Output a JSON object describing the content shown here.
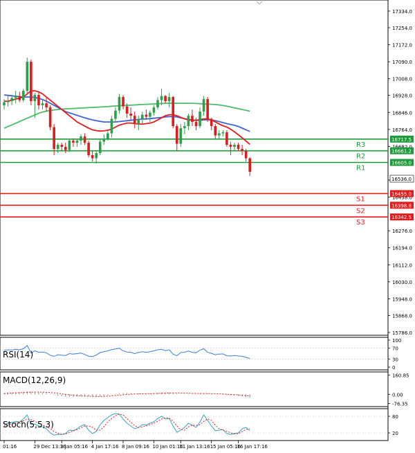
{
  "colors": {
    "up": "#2e9e4a",
    "down": "#d91e1e",
    "ma_fast": "#e81c1c",
    "ma_mid": "#3f63d6",
    "ma_slow": "#4cbc6a",
    "resistance": "#1f9a3a",
    "support": "#e01d1d",
    "rsi": "#3a7fd5",
    "macd": "#8a8a8a",
    "signal": "#e81c1c",
    "stoch_k": "#35a4c7",
    "stoch_d": "#e81c1c"
  },
  "chart_data": {
    "type": "candlestick",
    "main": {
      "y_ticks": [
        "17334.0",
        "17254.0",
        "17172.0",
        "17090.0",
        "17008.0",
        "16928.0",
        "16846.0",
        "16764.0",
        "16682.0",
        "16520.0",
        "16438.0",
        "16276.0",
        "16194.0",
        "16112.0",
        "16030.0",
        "15948.0",
        "15868.0",
        "15786.0"
      ],
      "ylim": [
        15786,
        17374
      ],
      "current_price": "16536.0",
      "candles": [
        {
          "o": 16880,
          "h": 16910,
          "l": 16860,
          "c": 16895
        },
        {
          "o": 16895,
          "h": 16925,
          "l": 16875,
          "c": 16900
        },
        {
          "o": 16900,
          "h": 16930,
          "l": 16880,
          "c": 16915
        },
        {
          "o": 16915,
          "h": 16950,
          "l": 16890,
          "c": 16925
        },
        {
          "o": 16925,
          "h": 16945,
          "l": 16895,
          "c": 16905
        },
        {
          "o": 16905,
          "h": 16960,
          "l": 16895,
          "c": 16950
        },
        {
          "o": 16950,
          "h": 17110,
          "l": 16930,
          "c": 17090
        },
        {
          "o": 17090,
          "h": 17100,
          "l": 16880,
          "c": 16900
        },
        {
          "o": 16900,
          "h": 16940,
          "l": 16820,
          "c": 16930
        },
        {
          "o": 16930,
          "h": 16945,
          "l": 16860,
          "c": 16880
        },
        {
          "o": 16880,
          "h": 16905,
          "l": 16860,
          "c": 16890
        },
        {
          "o": 16890,
          "h": 16915,
          "l": 16850,
          "c": 16870
        },
        {
          "o": 16870,
          "h": 16880,
          "l": 16760,
          "c": 16775
        },
        {
          "o": 16775,
          "h": 16790,
          "l": 16640,
          "c": 16670
        },
        {
          "o": 16670,
          "h": 16700,
          "l": 16650,
          "c": 16690
        },
        {
          "o": 16690,
          "h": 16700,
          "l": 16660,
          "c": 16680
        },
        {
          "o": 16680,
          "h": 16700,
          "l": 16650,
          "c": 16665
        },
        {
          "o": 16665,
          "h": 16720,
          "l": 16655,
          "c": 16710
        },
        {
          "o": 16710,
          "h": 16720,
          "l": 16680,
          "c": 16700
        },
        {
          "o": 16700,
          "h": 16720,
          "l": 16680,
          "c": 16710
        },
        {
          "o": 16710,
          "h": 16740,
          "l": 16690,
          "c": 16730
        },
        {
          "o": 16730,
          "h": 16745,
          "l": 16690,
          "c": 16700
        },
        {
          "o": 16700,
          "h": 16710,
          "l": 16630,
          "c": 16640
        },
        {
          "o": 16640,
          "h": 16660,
          "l": 16610,
          "c": 16625
        },
        {
          "o": 16625,
          "h": 16660,
          "l": 16600,
          "c": 16650
        },
        {
          "o": 16650,
          "h": 16720,
          "l": 16640,
          "c": 16705
        },
        {
          "o": 16705,
          "h": 16740,
          "l": 16690,
          "c": 16720
        },
        {
          "o": 16720,
          "h": 16760,
          "l": 16710,
          "c": 16745
        },
        {
          "o": 16745,
          "h": 16830,
          "l": 16725,
          "c": 16815
        },
        {
          "o": 16815,
          "h": 16870,
          "l": 16800,
          "c": 16855
        },
        {
          "o": 16855,
          "h": 16935,
          "l": 16840,
          "c": 16920
        },
        {
          "o": 16920,
          "h": 16930,
          "l": 16860,
          "c": 16875
        },
        {
          "o": 16875,
          "h": 16890,
          "l": 16820,
          "c": 16840
        },
        {
          "o": 16840,
          "h": 16870,
          "l": 16810,
          "c": 16830
        },
        {
          "o": 16830,
          "h": 16850,
          "l": 16770,
          "c": 16790
        },
        {
          "o": 16790,
          "h": 16830,
          "l": 16760,
          "c": 16815
        },
        {
          "o": 16815,
          "h": 16850,
          "l": 16790,
          "c": 16835
        },
        {
          "o": 16835,
          "h": 16860,
          "l": 16810,
          "c": 16825
        },
        {
          "o": 16825,
          "h": 16855,
          "l": 16800,
          "c": 16845
        },
        {
          "o": 16845,
          "h": 16880,
          "l": 16830,
          "c": 16870
        },
        {
          "o": 16870,
          "h": 16920,
          "l": 16860,
          "c": 16905
        },
        {
          "o": 16905,
          "h": 16960,
          "l": 16880,
          "c": 16925
        },
        {
          "o": 16925,
          "h": 16930,
          "l": 16890,
          "c": 16900
        },
        {
          "o": 16900,
          "h": 16940,
          "l": 16870,
          "c": 16920
        },
        {
          "o": 16920,
          "h": 16925,
          "l": 16770,
          "c": 16780
        },
        {
          "o": 16780,
          "h": 16790,
          "l": 16660,
          "c": 16695
        },
        {
          "o": 16695,
          "h": 16790,
          "l": 16680,
          "c": 16770
        },
        {
          "o": 16770,
          "h": 16800,
          "l": 16740,
          "c": 16780
        },
        {
          "o": 16780,
          "h": 16840,
          "l": 16760,
          "c": 16830
        },
        {
          "o": 16830,
          "h": 16860,
          "l": 16780,
          "c": 16800
        },
        {
          "o": 16800,
          "h": 16820,
          "l": 16760,
          "c": 16780
        },
        {
          "o": 16780,
          "h": 16870,
          "l": 16770,
          "c": 16850
        },
        {
          "o": 16850,
          "h": 16925,
          "l": 16830,
          "c": 16910
        },
        {
          "o": 16910,
          "h": 16920,
          "l": 16800,
          "c": 16815
        },
        {
          "o": 16815,
          "h": 16820,
          "l": 16760,
          "c": 16780
        },
        {
          "o": 16780,
          "h": 16790,
          "l": 16720,
          "c": 16735
        },
        {
          "o": 16735,
          "h": 16760,
          "l": 16715,
          "c": 16745
        },
        {
          "o": 16745,
          "h": 16760,
          "l": 16730,
          "c": 16750
        },
        {
          "o": 16750,
          "h": 16760,
          "l": 16680,
          "c": 16690
        },
        {
          "o": 16690,
          "h": 16705,
          "l": 16640,
          "c": 16680
        },
        {
          "o": 16680,
          "h": 16700,
          "l": 16660,
          "c": 16690
        },
        {
          "o": 16690,
          "h": 16700,
          "l": 16660,
          "c": 16670
        },
        {
          "o": 16670,
          "h": 16690,
          "l": 16640,
          "c": 16660
        },
        {
          "o": 16660,
          "h": 16670,
          "l": 16610,
          "c": 16625
        },
        {
          "o": 16625,
          "h": 16630,
          "l": 16540,
          "c": 16560
        }
      ],
      "ma_fast": [
        16900,
        16900,
        16905,
        16910,
        16915,
        16920,
        16935,
        16950,
        16950,
        16945,
        16935,
        16920,
        16905,
        16890,
        16875,
        16860,
        16845,
        16830,
        16815,
        16800,
        16790,
        16780,
        16770,
        16762,
        16758,
        16756,
        16757,
        16760,
        16765,
        16775,
        16785,
        16790,
        16795,
        16795,
        16792,
        16790,
        16790,
        16792,
        16795,
        16800,
        16810,
        16820,
        16830,
        16835,
        16835,
        16830,
        16822,
        16815,
        16810,
        16808,
        16808,
        16812,
        16815,
        16815,
        16810,
        16800,
        16790,
        16782,
        16775,
        16765,
        16752,
        16738,
        16724,
        16708,
        16692
      ],
      "ma_mid": [
        16930,
        16928,
        16926,
        16924,
        16922,
        16920,
        16920,
        16920,
        16918,
        16914,
        16908,
        16900,
        16890,
        16880,
        16870,
        16860,
        16850,
        16844,
        16838,
        16832,
        16826,
        16820,
        16815,
        16810,
        16806,
        16803,
        16800,
        16800,
        16800,
        16800,
        16802,
        16804,
        16806,
        16808,
        16810,
        16812,
        16814,
        16815,
        16816,
        16818,
        16820,
        16822,
        16824,
        16826,
        16826,
        16824,
        16820,
        16816,
        16812,
        16810,
        16808,
        16808,
        16810,
        16811,
        16810,
        16806,
        16802,
        16797,
        16792,
        16788,
        16784,
        16778,
        16770,
        16762,
        16754
      ],
      "ma_slow": [
        16770,
        16778,
        16786,
        16794,
        16802,
        16810,
        16818,
        16826,
        16834,
        16842,
        16848,
        16852,
        16856,
        16858,
        16860,
        16862,
        16863,
        16864,
        16865,
        16866,
        16867,
        16868,
        16869,
        16870,
        16871,
        16872,
        16873,
        16874,
        16876,
        16877,
        16878,
        16879,
        16880,
        16881,
        16882,
        16883,
        16884,
        16885,
        16886,
        16887,
        16888,
        16889,
        16890,
        16890,
        16890,
        16890,
        16890,
        16890,
        16890,
        16890,
        16889,
        16888,
        16887,
        16886,
        16885,
        16884,
        16882,
        16879,
        16876,
        16872,
        16868,
        16864,
        16860,
        16856,
        16852
      ],
      "levels": [
        {
          "name": "R3",
          "value": 16717.5,
          "label": "16717.5",
          "kind": "resistance"
        },
        {
          "name": "R2",
          "value": 16661.2,
          "label": "16661.2",
          "kind": "resistance"
        },
        {
          "name": "R1",
          "value": 16605.0,
          "label": "16605.0",
          "kind": "resistance"
        },
        {
          "name": "S1",
          "value": 16455.0,
          "label": "16455.0",
          "kind": "support"
        },
        {
          "name": "S2",
          "value": 16398.8,
          "label": "16398.8",
          "kind": "support"
        },
        {
          "name": "S3",
          "value": 16342.5,
          "label": "16342.5",
          "kind": "support"
        }
      ]
    },
    "rsi": {
      "title": "RSI(14)",
      "y_ticks": [
        "100",
        "70",
        "30",
        "0"
      ],
      "ylim": [
        0,
        100
      ],
      "values": [
        62,
        64,
        63,
        66,
        64,
        68,
        80,
        52,
        60,
        55,
        56,
        53,
        44,
        40,
        46,
        44,
        43,
        50,
        48,
        50,
        52,
        47,
        40,
        39,
        45,
        54,
        57,
        60,
        65,
        67,
        70,
        60,
        56,
        55,
        50,
        54,
        57,
        55,
        57,
        60,
        64,
        66,
        61,
        64,
        48,
        42,
        54,
        55,
        60,
        55,
        53,
        63,
        68,
        55,
        51,
        46,
        48,
        49,
        42,
        41,
        43,
        41,
        40,
        36,
        32
      ]
    },
    "macd": {
      "title": "MACD(12,26,9)",
      "y_ticks": [
        "160.85",
        "0.00",
        "-76.35"
      ],
      "ylim": [
        -80,
        165
      ],
      "histogram": [
        12,
        14,
        15,
        16,
        17,
        18,
        25,
        22,
        20,
        17,
        14,
        10,
        4,
        -6,
        -12,
        -16,
        -20,
        -20,
        -20,
        -19,
        -17,
        -16,
        -18,
        -20,
        -20,
        -16,
        -12,
        -8,
        -2,
        4,
        10,
        11,
        11,
        10,
        8,
        8,
        8,
        7,
        8,
        9,
        12,
        15,
        15,
        16,
        11,
        5,
        3,
        2,
        4,
        3,
        2,
        5,
        9,
        7,
        4,
        0,
        -2,
        -3,
        -6,
        -9,
        -11,
        -14,
        -17,
        -21,
        -28
      ],
      "signal": [
        6,
        8,
        10,
        12,
        14,
        15,
        17,
        18,
        19,
        19,
        18,
        17,
        15,
        12,
        8,
        4,
        0,
        -4,
        -8,
        -11,
        -13,
        -15,
        -16,
        -17,
        -18,
        -18,
        -17,
        -15,
        -13,
        -10,
        -7,
        -4,
        -1,
        1,
        3,
        4,
        5,
        6,
        6,
        7,
        8,
        9,
        10,
        11,
        12,
        12,
        11,
        10,
        9,
        8,
        7,
        7,
        7,
        7,
        6,
        5,
        4,
        3,
        1,
        -1,
        -3,
        -5,
        -8,
        -11,
        -15
      ]
    },
    "stoch": {
      "title": "Stoch(5,5,3)",
      "y_ticks": [
        "80",
        "20"
      ],
      "ylim": [
        0,
        100
      ],
      "k": [
        50,
        55,
        58,
        62,
        60,
        70,
        85,
        50,
        52,
        45,
        42,
        35,
        20,
        12,
        15,
        14,
        18,
        30,
        28,
        35,
        45,
        50,
        30,
        18,
        25,
        50,
        65,
        75,
        85,
        90,
        88,
        70,
        55,
        45,
        35,
        40,
        50,
        48,
        55,
        60,
        72,
        80,
        70,
        72,
        45,
        22,
        30,
        40,
        55,
        48,
        40,
        60,
        85,
        65,
        45,
        28,
        30,
        32,
        18,
        14,
        18,
        20,
        35,
        40,
        28
      ],
      "d": [
        45,
        48,
        52,
        56,
        60,
        63,
        70,
        68,
        62,
        55,
        48,
        43,
        35,
        25,
        18,
        15,
        16,
        22,
        27,
        32,
        38,
        45,
        45,
        40,
        30,
        30,
        42,
        60,
        72,
        82,
        88,
        85,
        72,
        58,
        46,
        40,
        42,
        45,
        50,
        55,
        62,
        70,
        75,
        73,
        62,
        45,
        32,
        30,
        42,
        48,
        47,
        50,
        62,
        70,
        65,
        48,
        35,
        30,
        26,
        20,
        16,
        17,
        25,
        32,
        35
      ]
    },
    "x_labels": [
      "01:16",
      "29 Dec 13:16",
      "3 Jan 05:16",
      "4 Jan 17:16",
      "8 Jan 09:16",
      "10 Jan 01:16",
      "11 Jan 13:16",
      "15 Jan 05:16",
      "16 Jan 17:16"
    ],
    "x_label_index": [
      0,
      8,
      15,
      23,
      31,
      39,
      46,
      54,
      61
    ]
  }
}
